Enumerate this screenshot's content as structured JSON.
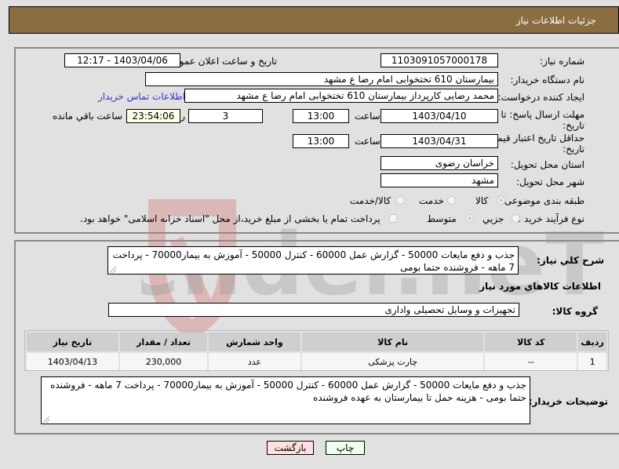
{
  "header": {
    "title": "جزئیات اطلاعات نیاز"
  },
  "fields": {
    "need_number": {
      "label": "شماره نیاز:",
      "value": "1103091057000178"
    },
    "announce_datetime": {
      "label": "تاریخ و ساعت اعلان عمومی:",
      "value": "1403/04/06 - 12:17"
    },
    "buyer_org": {
      "label": "نام دستگاه خریدار:",
      "value": "بیمارستان 610 تختخوابی امام رضا ع  مشهد"
    },
    "requester": {
      "label": "ایجاد کننده درخواست:",
      "value": "محمد رضایی کارپرداز بیمارستان 610 تختخوابی امام رضا ع  مشهد",
      "contact_link": "اطلاعات تماس خریدار"
    },
    "reply_deadline": {
      "label_line1": "مهلت ارسال پاسخ: تا",
      "label_line2": "تاریخ:",
      "date": "1403/04/10",
      "time_label": "ساعت",
      "time": "13:00",
      "days": "3",
      "days_label": "روز و",
      "remaining": "23:54:06",
      "remaining_label": "ساعت باقي مانده"
    },
    "price_validity": {
      "label_line1": "حداقل تاریخ اعتبار قیمت: تا",
      "label_line2": "تاریخ:",
      "date": "1403/04/31",
      "time_label": "ساعت",
      "time": "13:00"
    },
    "province": {
      "label": "استان محل تحویل:",
      "value": "خراسان رضوی"
    },
    "city": {
      "label": "شهر محل تحویل:",
      "value": "مشهد"
    },
    "category": {
      "label": "طبقه بندی موضوعی:",
      "options": [
        "کالا",
        "خدمت",
        "کالا/خدمت"
      ],
      "selected": "کالا"
    },
    "purchase_type": {
      "label": "نوع فرآیند خرید :",
      "options": [
        "جزیي",
        "متوسط"
      ],
      "selected": "متوسط",
      "treasury_note": "پرداخت تمام یا بخشی از مبلغ خرید،از محل \"اسناد خزانه اسلامی\" خواهد بود.",
      "treasury_checked": false
    }
  },
  "description": {
    "label": "شرح کلي نیاز:",
    "value": "جذب و دفع مایعات 50000 - گزارش عمل 60000 - کنترل 50000 - آموزش به بیمار70000 - پرداخت 7 ماهه - فروشنده حتما بومی"
  },
  "items_section": {
    "title": "اطلاعات کالاهاي مورد نیاز",
    "group_label": "گروه کالا:",
    "group_value": "تجهیزات و وسایل تحصیلی واداری",
    "columns": [
      "ردیف",
      "کد کالا",
      "نام کالا",
      "واحد شمارش",
      "تعداد / مقدار",
      "تاریخ نیاز"
    ],
    "rows": [
      [
        "1",
        "--",
        "چارت پزشکی",
        "عدد",
        "230,000",
        "1403/04/13"
      ]
    ]
  },
  "buyer_notes": {
    "label": "توضیحات خریدار:",
    "value": "جذب و دفع مایعات 50000 - گزارش عمل 60000 - کنترل 50000 - آموزش به بیمار70000 - پرداخت 7 ماهه - فروشنده حتما بومی - هزینه حمل تا بیمارستان به عهده فروشنده"
  },
  "buttons": {
    "print": "چاپ",
    "back": "بازگشت"
  },
  "colors": {
    "header_bg": "#8b6d42",
    "print_bg": "#eeffee",
    "back_bg": "#ffe0e0",
    "link": "#3333cc"
  },
  "watermark": {
    "text": "AriaTender.neT"
  }
}
